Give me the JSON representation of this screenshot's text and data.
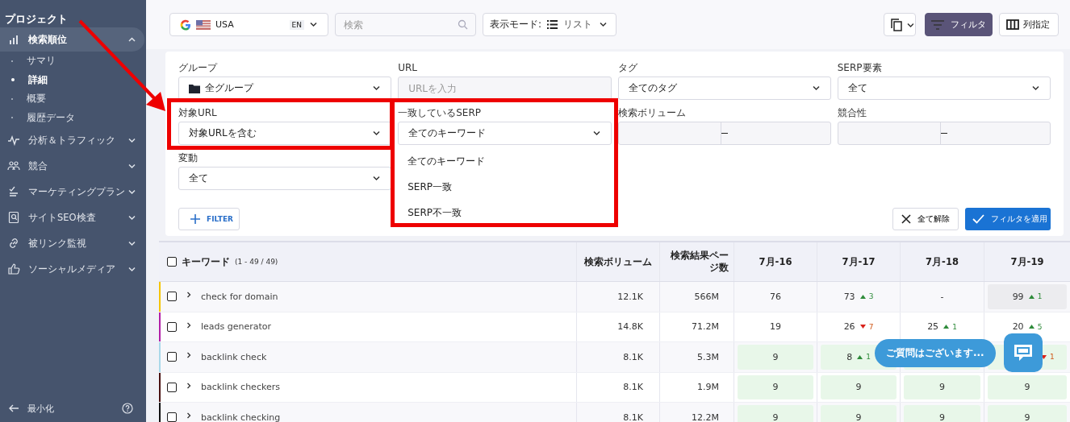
{
  "sidebar": {
    "title": "プロジェクト",
    "items": [
      {
        "label": "検索順位",
        "expanded": true,
        "selected": true,
        "children": [
          {
            "label": "サマリ",
            "selected": false
          },
          {
            "label": "詳細",
            "selected": true
          },
          {
            "label": "概要",
            "selected": false
          },
          {
            "label": "履歴データ",
            "selected": false
          }
        ]
      },
      {
        "label": "分析＆トラフィック",
        "expanded": false,
        "selected": false
      },
      {
        "label": "競合",
        "expanded": false,
        "selected": false
      },
      {
        "label": "マーケティングプラン",
        "expanded": false,
        "selected": false
      },
      {
        "label": "サイトSEO検査",
        "expanded": false,
        "selected": false
      },
      {
        "label": "被リンク監視",
        "expanded": false,
        "selected": false
      },
      {
        "label": "ソーシャルメディア",
        "expanded": false,
        "selected": false
      }
    ],
    "footer": "最小化"
  },
  "toolbar": {
    "engine": {
      "country": "USA",
      "language": "EN"
    },
    "search": {
      "placeholder": "検索"
    },
    "view_mode": {
      "label": "表示モード:",
      "value": "リスト"
    },
    "buttons": [
      {
        "kind": "copy",
        "selected": false
      },
      {
        "kind": "filter",
        "label": "フィルタ",
        "selected": true
      },
      {
        "kind": "columns",
        "label": "列指定",
        "selected": false
      }
    ]
  },
  "filters": {
    "fields": [
      {
        "label": "グループ",
        "kind": "folder_select",
        "value": "全グループ"
      },
      {
        "label": "URL",
        "kind": "input",
        "placeholder": "URLを入力"
      },
      {
        "label": "タグ",
        "kind": "select",
        "value": "全てのタグ"
      },
      {
        "label": "SERP要素",
        "kind": "select",
        "value": "全て"
      },
      {
        "label": "対象URL",
        "kind": "select",
        "value": "対象URLを含む"
      },
      {
        "label": "一致しているSERP",
        "kind": "select",
        "value": "全てのキーワード",
        "expanded": true,
        "options": [
          "全てのキーワード",
          "SERP一致",
          "SERP不一致"
        ]
      },
      {
        "label": "検索ボリューム",
        "kind": "range"
      },
      {
        "label": "競合性",
        "kind": "range"
      },
      {
        "label": "変動",
        "kind": "select",
        "value": "全て"
      }
    ],
    "add_button": "FILTER",
    "clear_button": "全て解除",
    "apply_button": "フィルタを適用"
  },
  "table": {
    "columns": [
      {
        "label": "キーワード",
        "count": "(1 - 49 / 49)",
        "checked": false
      },
      {
        "label": "検索ボリューム"
      },
      {
        "label": "検索結果ページ数"
      },
      {
        "label": "7月-16"
      },
      {
        "label": "7月-17"
      },
      {
        "label": "7月-18"
      },
      {
        "label": "7月-19"
      }
    ],
    "rows": [
      {
        "color": "#f5c400",
        "checked": false,
        "keyword": "check for domain",
        "volume": "12.1K",
        "serp_pages": "566M",
        "positions": [
          {
            "kind": "plain",
            "value": "76"
          },
          {
            "kind": "plain",
            "value": "73",
            "change": "3",
            "improved": true
          },
          {
            "kind": "plain",
            "value": "-"
          },
          {
            "kind": "shaded",
            "value": "99",
            "change": "1",
            "improved": true
          }
        ]
      },
      {
        "color": "#b21fa8",
        "checked": false,
        "keyword": "leads generator",
        "volume": "14.8K",
        "serp_pages": "71.2M",
        "positions": [
          {
            "kind": "plain",
            "value": "19"
          },
          {
            "kind": "plain",
            "value": "26",
            "change": "7",
            "improved": false
          },
          {
            "kind": "plain",
            "value": "25",
            "change": "1",
            "improved": true
          },
          {
            "kind": "plain",
            "value": "20",
            "change": "5",
            "improved": true
          }
        ]
      },
      {
        "color": "#a9d8ea",
        "checked": false,
        "keyword": "backlink check",
        "volume": "8.1K",
        "serp_pages": "5.3M",
        "positions": [
          {
            "kind": "top",
            "value": "9"
          },
          {
            "kind": "top",
            "value": "8",
            "change": "1",
            "improved": true
          },
          {
            "kind": "top"
          },
          {
            "kind": "top",
            "change": "1",
            "improved": false
          }
        ]
      },
      {
        "color": "#4a1212",
        "checked": false,
        "keyword": "backlink checkers",
        "volume": "8.1K",
        "serp_pages": "1.9M",
        "positions": [
          {
            "kind": "top",
            "value": "9"
          },
          {
            "kind": "top",
            "value": "9"
          },
          {
            "kind": "top",
            "value": "9"
          },
          {
            "kind": "top",
            "value": "9"
          }
        ]
      },
      {
        "color": "#111111",
        "checked": false,
        "keyword": "backlink checking",
        "volume": "8.1K",
        "serp_pages": "12.2M",
        "positions": [
          {
            "kind": "top",
            "value": "9"
          },
          {
            "kind": "top",
            "value": "9"
          },
          {
            "kind": "top",
            "value": "9"
          },
          {
            "kind": "top",
            "value": "9"
          }
        ]
      }
    ]
  },
  "chat": {
    "bubble": "ご質問はございます..."
  },
  "annotations": [
    {
      "kind": "arrow"
    },
    {
      "kind": "frame"
    },
    {
      "kind": "frame"
    }
  ]
}
